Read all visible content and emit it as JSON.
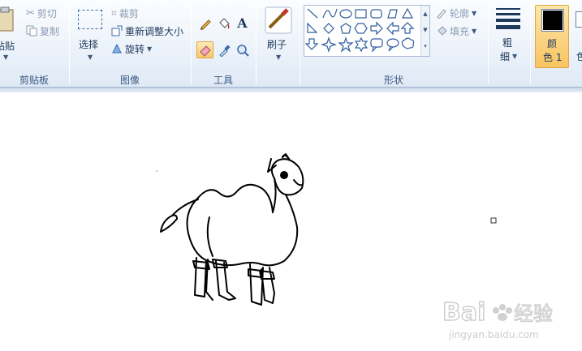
{
  "clipboard": {
    "paste_label": "粘贴",
    "cut_label": "剪切",
    "copy_label": "复制",
    "group_label": "剪贴板"
  },
  "image": {
    "select_label": "选择",
    "crop_label": "裁剪",
    "resize_label": "重新调整大小",
    "rotate_label": "旋转",
    "group_label": "图像"
  },
  "tools": {
    "text_glyph": "A",
    "group_label": "工具"
  },
  "brushes": {
    "label": "刷子"
  },
  "shapes": {
    "outline_label": "轮廓",
    "fill_label": "填充",
    "group_label": "形状"
  },
  "size": {
    "label_line1": "粗",
    "label_line2": "细"
  },
  "colors": {
    "color1_line1": "颜",
    "color1_line2": "色 1",
    "color2_line2": "色",
    "color1_value": "#000000"
  },
  "watermark": {
    "brand": "Bai",
    "brand_suffix": "经验",
    "url": "jingyan.baidu.com"
  }
}
